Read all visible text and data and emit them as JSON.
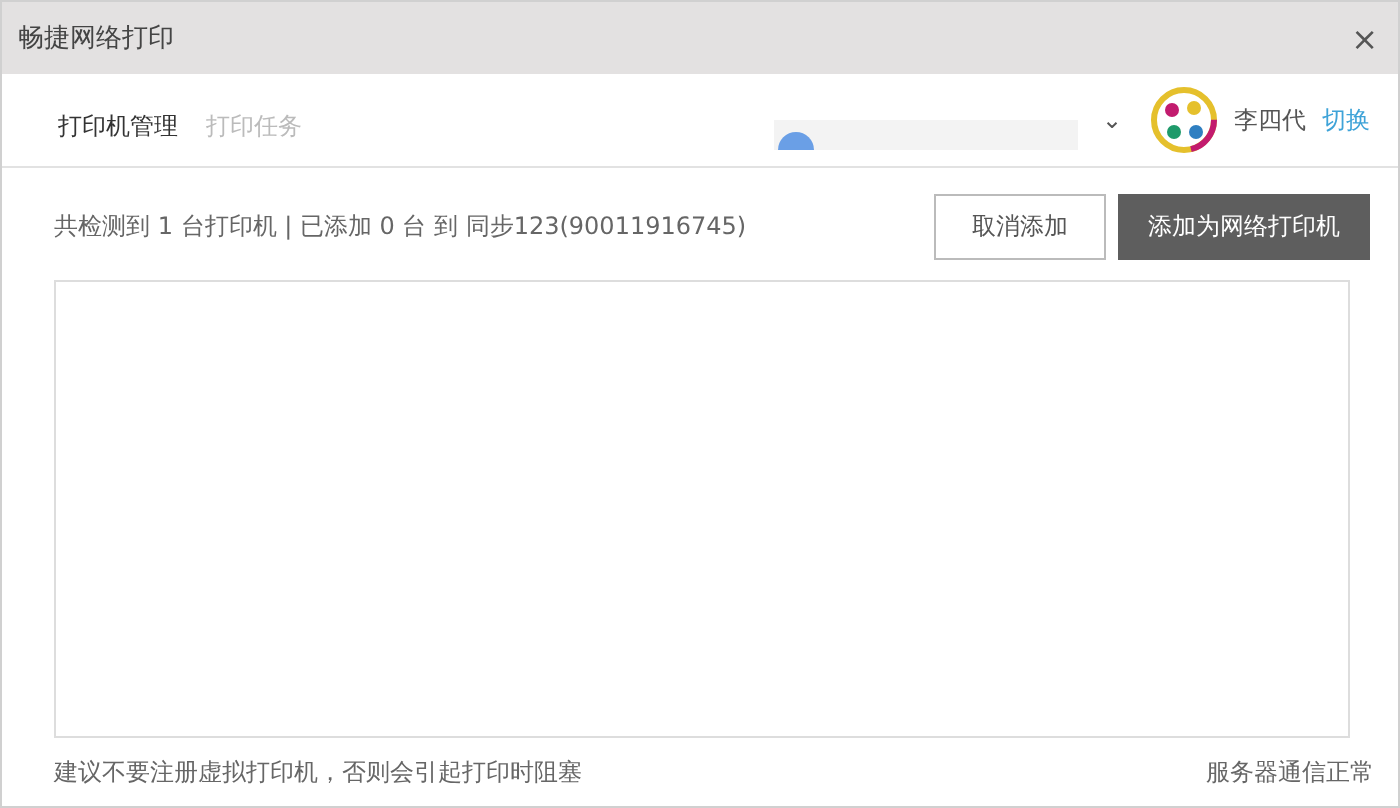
{
  "window": {
    "title": "畅捷网络打印",
    "close": "×"
  },
  "tabs": [
    {
      "label": "打印机管理",
      "selected": true
    },
    {
      "label": "打印任务",
      "selected": false
    }
  ],
  "account_dropdown": {
    "caret": "⌄"
  },
  "user": {
    "name": "李四代",
    "switch_link": "切换"
  },
  "summary": {
    "text": "共检测到 1 台打印机 | 已添加 0 台 到 同步123(90011916745)"
  },
  "buttons": [
    {
      "label": "取消添加",
      "kind": "secondary"
    },
    {
      "label": "添加为网络打印机",
      "kind": "primary"
    }
  ],
  "footer": {
    "tip": "建议不要注册虚拟打印机，否则会引起打印时阻塞",
    "status": "服务器通信正常"
  }
}
